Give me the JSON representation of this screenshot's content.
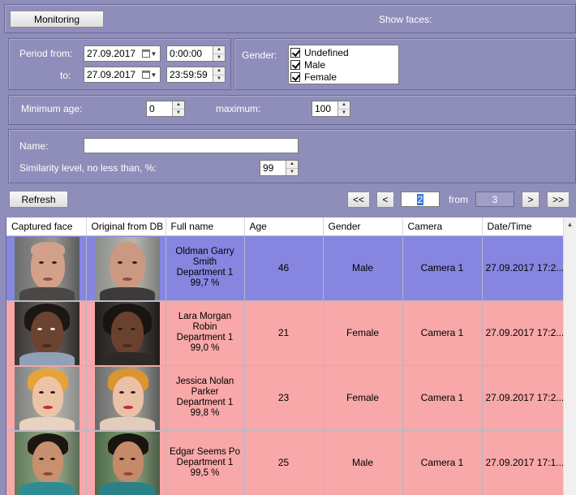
{
  "toolbar": {
    "monitoring_label": "Monitoring",
    "show_faces_label": "Show faces:"
  },
  "period": {
    "from_label": "Period from:",
    "to_label": "to:",
    "from_date": "27.09.2017",
    "from_time": "0:00:00",
    "to_date": "27.09.2017",
    "to_time": "23:59:59"
  },
  "gender_filter": {
    "label": "Gender:",
    "options": [
      {
        "label": "Undefined",
        "checked": true
      },
      {
        "label": "Male",
        "checked": true
      },
      {
        "label": "Female",
        "checked": true
      }
    ]
  },
  "age_filter": {
    "min_label": "Minimum age:",
    "min_value": "0",
    "max_label": "maximum:",
    "max_value": "100"
  },
  "name_filter": {
    "label": "Name:",
    "value": "",
    "similarity_label": "Similarity level, no less than, %:",
    "similarity_value": "99"
  },
  "actions": {
    "refresh_label": "Refresh"
  },
  "pagination": {
    "first": "<<",
    "prev": "<",
    "current": "2",
    "from_label": "from",
    "total": "3",
    "next": ">",
    "last": ">>"
  },
  "table": {
    "columns": [
      "Captured face",
      "Original from DB",
      "Full name",
      "Age",
      "Gender",
      "Camera",
      "Date/Time"
    ],
    "rows": [
      {
        "name": "Oldman Garry Smith",
        "department": "Department 1",
        "similarity": "99,7 %",
        "age": "46",
        "gender": "Male",
        "camera": "Camera 1",
        "datetime": "27.09.2017 17:2...",
        "selected": true
      },
      {
        "name": "Lara Morgan Robin",
        "department": "Department 1",
        "similarity": "99,0 %",
        "age": "21",
        "gender": "Female",
        "camera": "Camera 1",
        "datetime": "27.09.2017 17:2...",
        "selected": false
      },
      {
        "name": "Jessica Nolan Parker",
        "department": "Department 1",
        "similarity": "99,8 %",
        "age": "23",
        "gender": "Female",
        "camera": "Camera 1",
        "datetime": "27.09.2017 17:2...",
        "selected": false
      },
      {
        "name": "Edgar Seems Po",
        "department": "Department 1",
        "similarity": "99,5 %",
        "age": "25",
        "gender": "Male",
        "camera": "Camera 1",
        "datetime": "27.09.2017 17:1...",
        "selected": false
      }
    ]
  },
  "colors": {
    "panel_bg": "#8f8eba",
    "selected_row": "#8686e0",
    "row_bg": "#f8a8a8"
  },
  "icons": {
    "calendar": "calendar-icon",
    "spin": "spin-arrows-icon",
    "scroll_up": "scroll-up-icon"
  }
}
